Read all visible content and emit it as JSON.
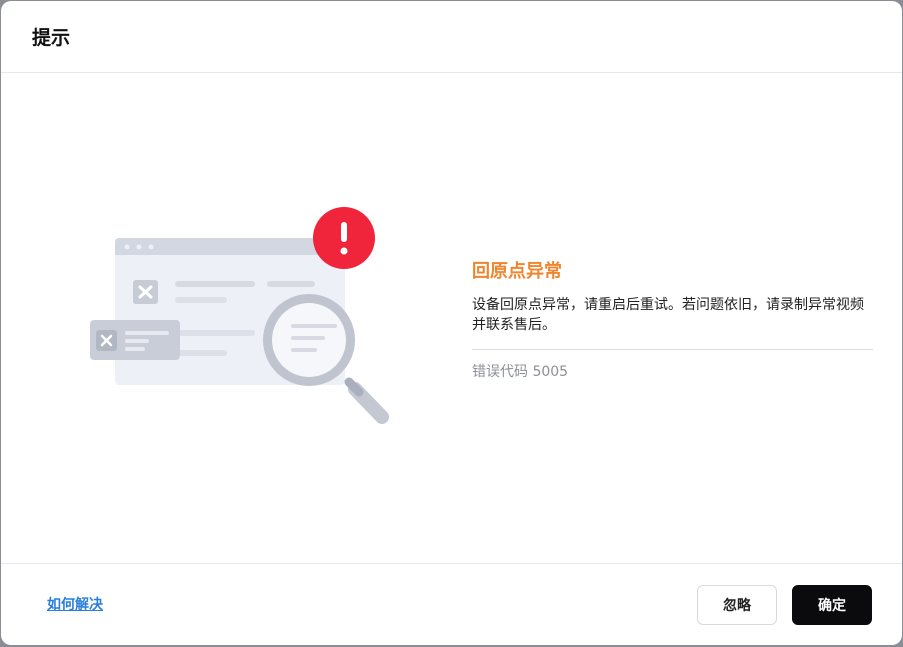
{
  "dialog": {
    "title": "提示"
  },
  "error": {
    "title": "回原点异常",
    "description": "设备回原点异常，请重启后重试。若问题依旧，请录制异常视频并联系售后。",
    "code": "错误代码 5005"
  },
  "footer": {
    "help_link": "如何解决",
    "ignore_label": "忽略",
    "confirm_label": "确定"
  },
  "colors": {
    "accent_error": "#f0852d",
    "alert_badge": "#f0243a",
    "link": "#2a7fdc",
    "primary_button": "#0b0b0d"
  },
  "icons": {
    "illustration": "error-window-magnifier-illustration",
    "alert": "exclamation-icon"
  }
}
